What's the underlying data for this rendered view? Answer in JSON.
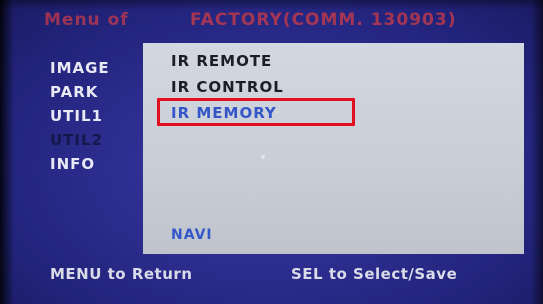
{
  "title": {
    "left": "Menu of",
    "right": "FACTORY(COMM. 130903)"
  },
  "left_menu": {
    "items": [
      {
        "label": "IMAGE"
      },
      {
        "label": "PARK"
      },
      {
        "label": "UTIL1"
      },
      {
        "label": "UTIL2"
      },
      {
        "label": "INFO"
      }
    ]
  },
  "panel": {
    "options": [
      {
        "label": "IR REMOTE"
      },
      {
        "label": "IR CONTROL"
      },
      {
        "label": "IR MEMORY"
      }
    ],
    "selected": "IR MEMORY",
    "bottom_option": "NAVI"
  },
  "footer": {
    "left": "MENU to Return",
    "right": "SEL to Select/Save"
  },
  "colors": {
    "background": "#2c2c8e",
    "panel": "#cfd3dc",
    "selected_text": "#3456c8",
    "highlight_border": "#e0101e",
    "title_text": "#c43a4a"
  }
}
